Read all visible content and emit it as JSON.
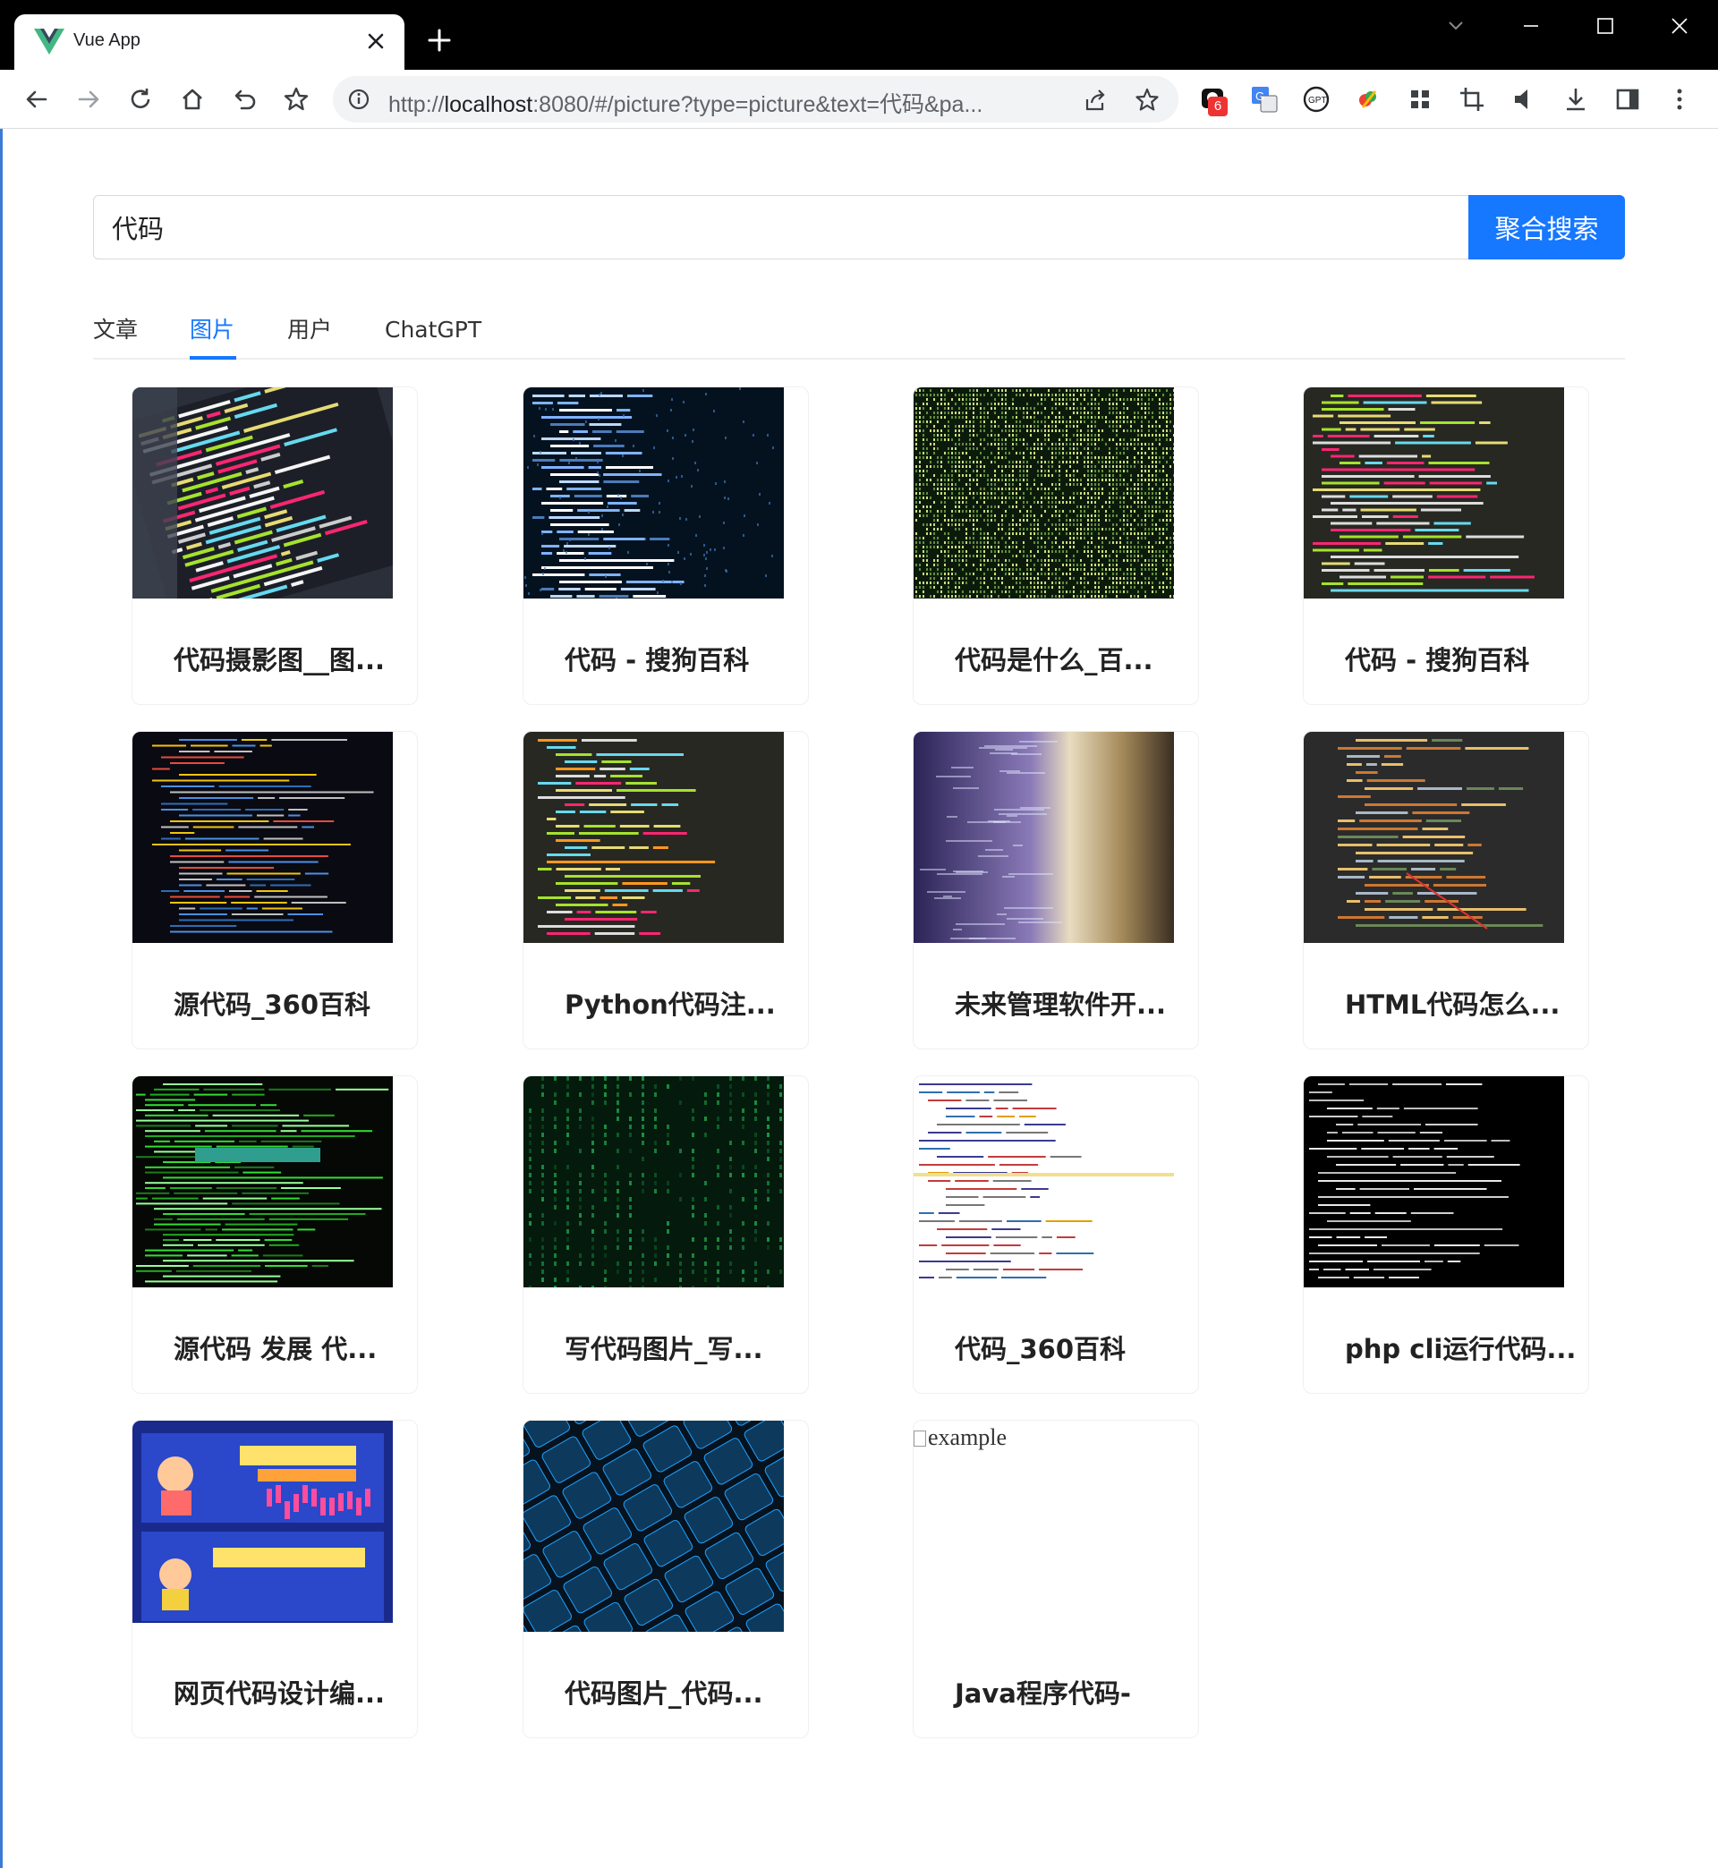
{
  "browser": {
    "tab_title": "Vue App",
    "url_scheme": "http://",
    "url_host": "localhost",
    "url_rest": ":8080/#/picture?type=picture&text=代码&pa...",
    "extension_badge": "6"
  },
  "search": {
    "value": "代码",
    "button_label": "聚合搜索"
  },
  "tabs": [
    {
      "label": "文章",
      "active": false
    },
    {
      "label": "图片",
      "active": true
    },
    {
      "label": "用户",
      "active": false
    },
    {
      "label": "ChatGPT",
      "active": false
    }
  ],
  "pictures": [
    {
      "title": "代码摄影图__图...",
      "style": "code-dark-angle"
    },
    {
      "title": "代码 - 搜狗百科",
      "style": "code-blue-matrix"
    },
    {
      "title": "代码是什么_百...",
      "style": "binary-green"
    },
    {
      "title": "代码 - 搜狗百科",
      "style": "code-editor"
    },
    {
      "title": "源代码_360百科",
      "style": "terminal-blue"
    },
    {
      "title": "Python代码注...",
      "style": "python-editor"
    },
    {
      "title": "未来管理软件开...",
      "style": "blur-purple"
    },
    {
      "title": "HTML代码怎么...",
      "style": "html-editor"
    },
    {
      "title": "源代码 发展 代...",
      "style": "green-terminal"
    },
    {
      "title": "写代码图片_写...",
      "style": "matrix-green"
    },
    {
      "title": "代码_360百科",
      "style": "light-doc"
    },
    {
      "title": "php cli运行代码...",
      "style": "black-terminal"
    },
    {
      "title": "网页代码设计编...",
      "style": "kids-poster"
    },
    {
      "title": "代码图片_代码...",
      "style": "keyboard-blue"
    },
    {
      "title": "Java程序代码-",
      "style": "broken",
      "alt": "example"
    }
  ]
}
